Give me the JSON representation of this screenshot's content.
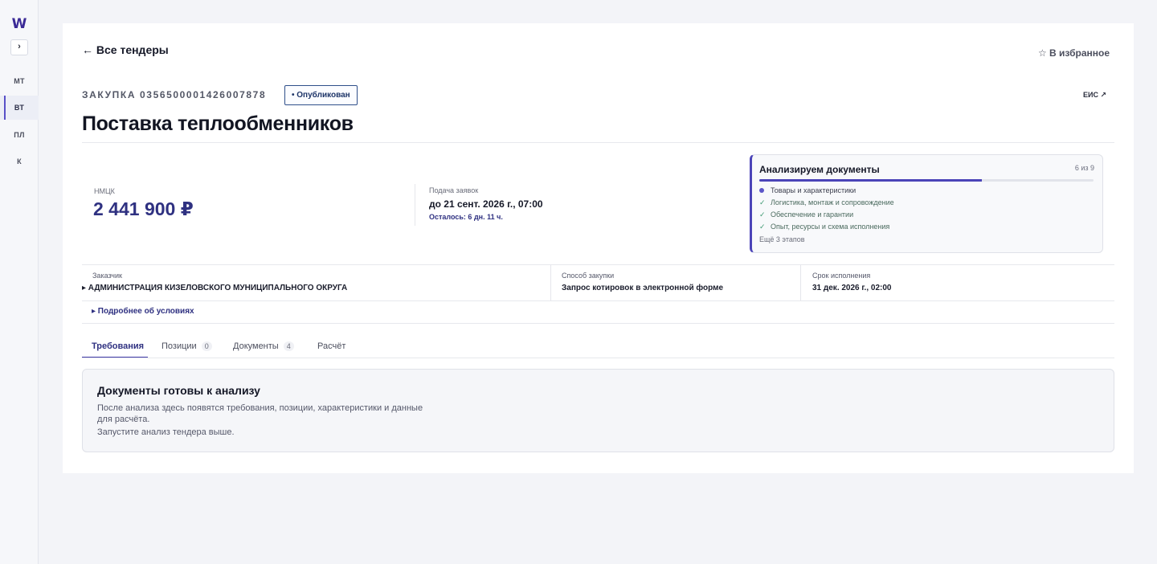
{
  "sidebar": {
    "logo": "W",
    "collapse_icon": "›",
    "items": [
      {
        "label": "МТ",
        "active": false
      },
      {
        "label": "ВТ",
        "active": true
      },
      {
        "label": "ПЛ",
        "active": false
      },
      {
        "label": "К",
        "active": false
      }
    ]
  },
  "header": {
    "back_label": "← Все тендеры",
    "favorite_label": "☆ В избранное",
    "procurement_label": "ЗАКУПКА 0356500001426007878",
    "status": "• Опубликован",
    "eis_link": "ЕИС ↗",
    "title": "Поставка теплообменников"
  },
  "summary": {
    "nmck_label": "НМЦК",
    "nmck_value": "2 441 900 ₽",
    "deadline_label": "Подача заявок",
    "deadline_value": "до 21 сент. 2026 г., 07:00",
    "deadline_left": "Осталось: 6 дн. 11 ч."
  },
  "analysis": {
    "title": "Анализируем документы",
    "count": "6 из 9",
    "progress": 0.667,
    "stages": [
      {
        "label": "Товары и характеристики",
        "status": "current",
        "mark": ""
      },
      {
        "label": "Логистика, монтаж и сопровождение",
        "status": "done",
        "mark": "✓"
      },
      {
        "label": "Обеспечение и гарантии",
        "status": "done",
        "mark": "✓"
      },
      {
        "label": "Опыт, ресурсы и схема исполнения",
        "status": "done",
        "mark": "✓"
      }
    ],
    "more": "Ещё 3 этапов"
  },
  "info": {
    "customer_label": "Заказчик",
    "customer_value": "▸ АДМИНИСТРАЦИЯ КИЗЕЛОВСКОГО МУНИЦИПАЛЬНОГО ОКРУГА",
    "method_label": "Способ закупки",
    "method_value": "Запрос котировок в электронной форме",
    "term_label": "Срок исполнения",
    "term_value": "31 дек. 2026 г., 02:00"
  },
  "more_terms": "▸ Подробнее об условиях",
  "tabs": [
    {
      "label": "Требования",
      "count": "",
      "active": true
    },
    {
      "label": "Позиции",
      "count": "0",
      "active": false
    },
    {
      "label": "Документы",
      "count": "4",
      "active": false
    },
    {
      "label": "Расчёт",
      "count": "",
      "active": false
    }
  ],
  "empty": {
    "title": "Документы готовы к анализу",
    "text": "После анализа здесь появятся требования, позиции, характеристики и данные для расчёта.",
    "hint": "Запустите анализ тендера выше."
  },
  "colors": {
    "accent": "#2f3181",
    "brand": "#3b2a96",
    "progress": "#4b44b8",
    "done_check": "#3f9a73"
  }
}
